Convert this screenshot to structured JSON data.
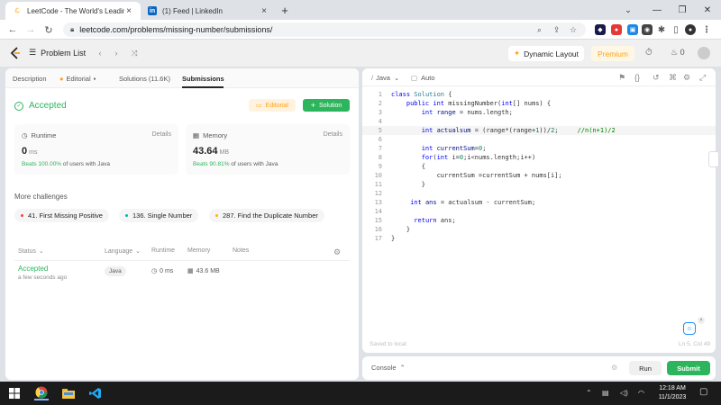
{
  "browser": {
    "tabs": [
      {
        "title": "LeetCode - The World's Leading",
        "active": true
      },
      {
        "title": "(1) Feed | LinkedIn",
        "active": false
      }
    ],
    "url": "leetcode.com/problems/missing-number/submissions/"
  },
  "lc_nav": {
    "problem_list": "Problem List",
    "dynamic_layout": "Dynamic Layout",
    "premium": "Premium",
    "notifications": "0"
  },
  "left": {
    "tabs": [
      {
        "label": "Description"
      },
      {
        "label": "Editorial"
      },
      {
        "label": "Solutions (11.6K)"
      },
      {
        "label": "Submissions"
      }
    ],
    "status": "Accepted",
    "editorial_btn": "Editorial",
    "solution_btn": "Solution",
    "runtime": {
      "label": "Runtime",
      "details": "Details",
      "value": "0",
      "unit": "ms",
      "beats_pct": "Beats 100.00%",
      "beats_rest": "of users with Java"
    },
    "memory": {
      "label": "Memory",
      "details": "Details",
      "value": "43.64",
      "unit": "MB",
      "beats_pct": "Beats 90.81%",
      "beats_rest": "of users with Java"
    },
    "more_title": "More challenges",
    "challenges": [
      {
        "label": "41. First Missing Positive",
        "color": "#ef4743"
      },
      {
        "label": "136. Single Number",
        "color": "#00b8a3"
      },
      {
        "label": "287. Find the Duplicate Number",
        "color": "#ffb800"
      }
    ],
    "table": {
      "headers": {
        "status": "Status",
        "language": "Language",
        "runtime": "Runtime",
        "memory": "Memory",
        "notes": "Notes"
      },
      "row": {
        "status": "Accepted",
        "time": "a few seconds ago",
        "language": "Java",
        "runtime": "0 ms",
        "memory": "43.6 MB"
      }
    }
  },
  "editor": {
    "language": "Java",
    "auto": "Auto",
    "saved": "Saved to local",
    "cursor": "Ln 5, Col 49"
  },
  "console": {
    "label": "Console",
    "run": "Run",
    "submit": "Submit"
  },
  "taskbar": {
    "time": "12:18 AM",
    "date": "11/1/2023"
  }
}
